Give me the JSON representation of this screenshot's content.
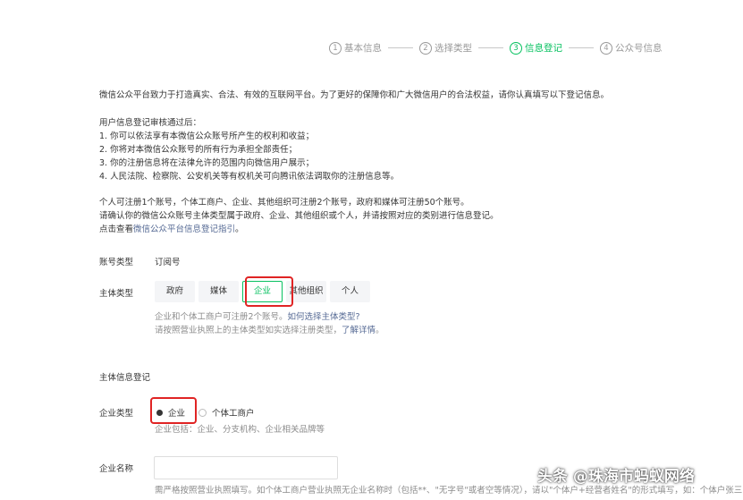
{
  "steps": [
    {
      "num": "1",
      "label": "基本信息"
    },
    {
      "num": "2",
      "label": "选择类型"
    },
    {
      "num": "3",
      "label": "信息登记"
    },
    {
      "num": "4",
      "label": "公众号信息"
    }
  ],
  "intro": "微信公众平台致力于打造真实、合法、有效的互联网平台。为了更好的保障你和广大微信用户的合法权益，请你认真填写以下登记信息。",
  "review": {
    "title": "用户信息登记审核通过后：",
    "items": [
      "1. 你可以依法享有本微信公众账号所产生的权利和收益；",
      "2. 你将对本微信公众账号的所有行为承担全部责任；",
      "3. 你的注册信息将在法律允许的范围内向微信用户展示；",
      "4. 人民法院、检察院、公安机关等有权机关可向腾讯依法调取你的注册信息等。"
    ]
  },
  "limits": {
    "line1": "个人可注册1个账号，个体工商户、企业、其他组织可注册2个账号，政府和媒体可注册50个账号。",
    "line2": "请确认你的微信公众账号主体类型属于政府、企业、其他组织或个人，并请按照对应的类别进行信息登记。",
    "line3_prefix": "点击查看",
    "line3_link": "微信公众平台信息登记指引",
    "line3_suffix": "。"
  },
  "account_type": {
    "label": "账号类型",
    "value": "订阅号"
  },
  "subject_type": {
    "label": "主体类型",
    "options": [
      "政府",
      "媒体",
      "企业",
      "其他组织",
      "个人"
    ],
    "selected": "企业",
    "hint1_prefix": "企业和个体工商户可注册2个账号。",
    "hint1_link": "如何选择主体类型?",
    "hint2_prefix": "请按照营业执照上的主体类型如实选择注册类型，",
    "hint2_link": "了解详情",
    "hint2_suffix": "。"
  },
  "section_title": "主体信息登记",
  "company_type": {
    "label": "企业类型",
    "options": [
      "企业",
      "个体工商户"
    ],
    "selected": "企业",
    "hint": "企业包括：企业、分支机构、企业相关品牌等"
  },
  "company_name": {
    "label": "企业名称",
    "value": "",
    "hint": "需严格按照营业执照填写。如个体工商户营业执照无企业名称时（包括**、\"无字号\"或者空等情况），请以\"个体户+经营者姓名\"的形式填写，如：个体户张三"
  },
  "watermark": "头条 @珠海市蚂蚁网络",
  "colors": {
    "accent": "#07c160",
    "link": "#576b95",
    "highlight": "#e02424"
  }
}
